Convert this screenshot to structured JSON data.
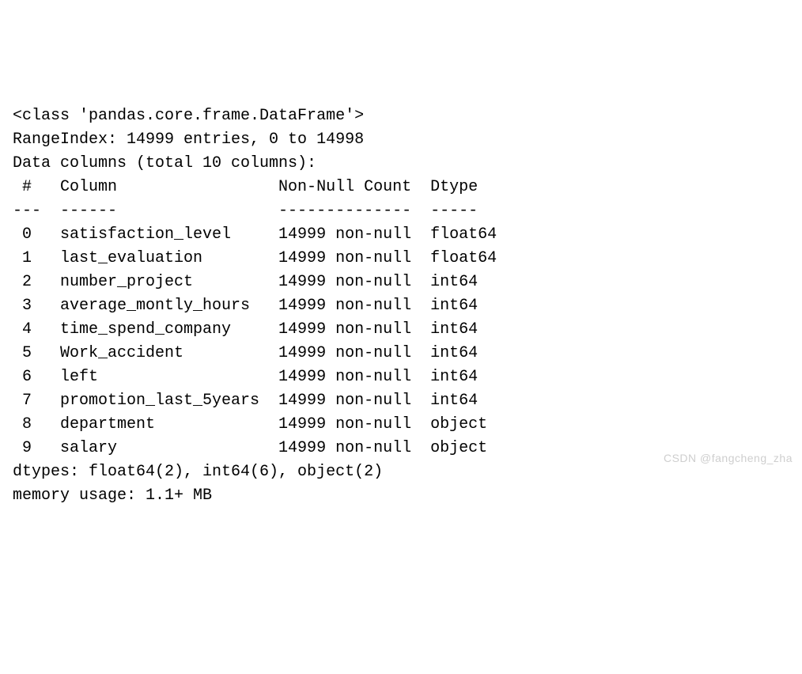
{
  "info": {
    "class_line": "<class 'pandas.core.frame.DataFrame'>",
    "index_line": "RangeIndex: 14999 entries, 0 to 14998",
    "columns_header": "Data columns (total 10 columns):",
    "table_header": {
      "num": " # ",
      "column": "Column",
      "nonnull": "Non-Null Count",
      "dtype": "Dtype"
    },
    "divider": {
      "num": "---",
      "column": "------",
      "nonnull": "--------------",
      "dtype": "-----"
    },
    "rows": [
      {
        "idx": " 0 ",
        "name": "satisfaction_level",
        "count": "14999 non-null",
        "dtype": "float64"
      },
      {
        "idx": " 1 ",
        "name": "last_evaluation",
        "count": "14999 non-null",
        "dtype": "float64"
      },
      {
        "idx": " 2 ",
        "name": "number_project",
        "count": "14999 non-null",
        "dtype": "int64"
      },
      {
        "idx": " 3 ",
        "name": "average_montly_hours",
        "count": "14999 non-null",
        "dtype": "int64"
      },
      {
        "idx": " 4 ",
        "name": "time_spend_company",
        "count": "14999 non-null",
        "dtype": "int64"
      },
      {
        "idx": " 5 ",
        "name": "Work_accident",
        "count": "14999 non-null",
        "dtype": "int64"
      },
      {
        "idx": " 6 ",
        "name": "left",
        "count": "14999 non-null",
        "dtype": "int64"
      },
      {
        "idx": " 7 ",
        "name": "promotion_last_5years",
        "count": "14999 non-null",
        "dtype": "int64"
      },
      {
        "idx": " 8 ",
        "name": "department",
        "count": "14999 non-null",
        "dtype": "object"
      },
      {
        "idx": " 9 ",
        "name": "salary",
        "count": "14999 non-null",
        "dtype": "object"
      }
    ],
    "dtypes_line": "dtypes: float64(2), int64(6), object(2)",
    "memory_line": "memory usage: 1.1+ MB"
  },
  "watermark": "CSDN @fangcheng_zha"
}
